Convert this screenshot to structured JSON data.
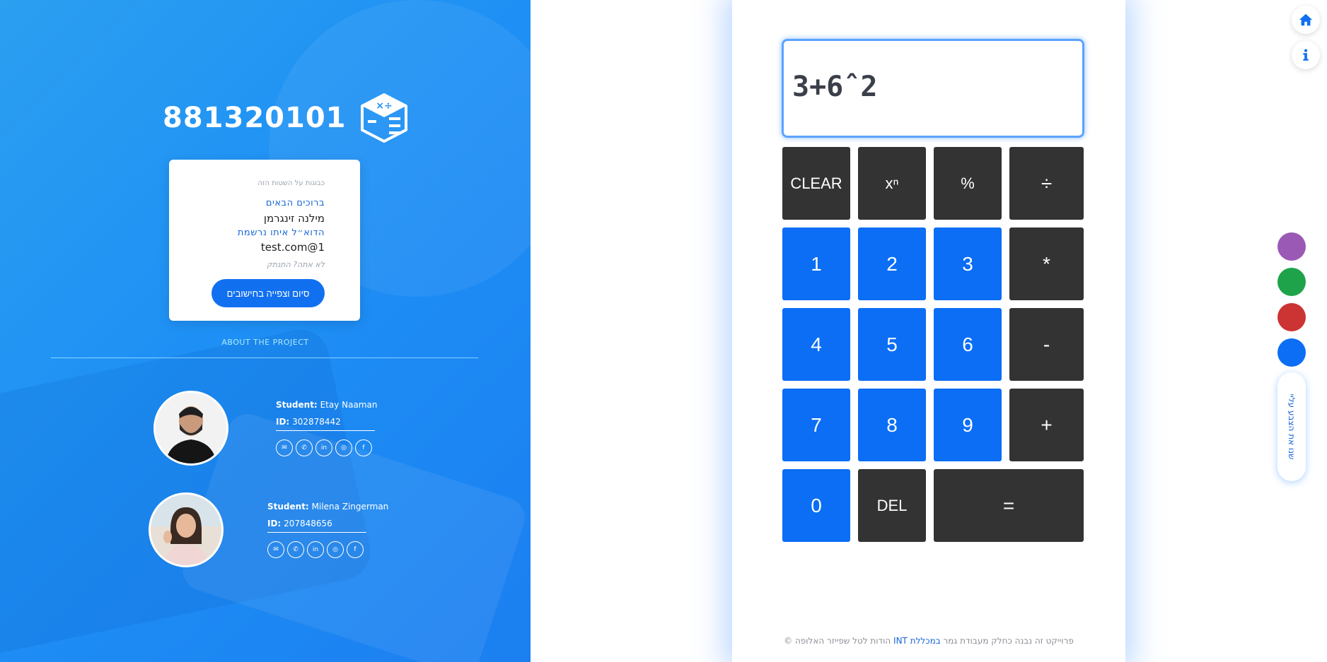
{
  "brand": {
    "number": "881320101"
  },
  "card": {
    "small_text": "כבוגות על השטות הזה",
    "welcome": "ברוכים הבאים",
    "username": "מילנה זינגרמן",
    "registered_label": "הדוא״ל איתו נרשמת",
    "email": "test.com@1",
    "not_you": "לא אתה? התנתק",
    "finish_button": "סיום וצפייה בחישובים"
  },
  "about": "ABOUT THE PROJECT",
  "students": [
    {
      "label": "Student:",
      "name": "Etay Naaman",
      "id_label": "ID:",
      "id": "302878442"
    },
    {
      "label": "Student:",
      "name": "Milena Zingerman",
      "id_label": "ID:",
      "id": "207848656"
    }
  ],
  "socials": [
    {
      "icon": "mail-icon",
      "glyph": "✉"
    },
    {
      "icon": "phone-icon",
      "glyph": "✆"
    },
    {
      "icon": "linkedin-icon",
      "glyph": "in"
    },
    {
      "icon": "instagram-icon",
      "glyph": "◎"
    },
    {
      "icon": "facebook-icon",
      "glyph": "f"
    }
  ],
  "calculator": {
    "display": "3+6ˆ2",
    "keys": {
      "clear": "CLEAR",
      "power": "xⁿ",
      "percent": "%",
      "divide": "÷",
      "one": "1",
      "two": "2",
      "three": "3",
      "multiply": "*",
      "four": "4",
      "five": "5",
      "six": "6",
      "minus": "-",
      "seven": "7",
      "eight": "8",
      "nine": "9",
      "plus": "+",
      "zero": "0",
      "del": "DEL",
      "equals": "="
    }
  },
  "footer": {
    "part1": "פרוייקט זה נבנה כחלק מעבודת גמר ",
    "highlight": "במכללת INT",
    "part2": " הודות לטל שפייזר האלופה ©"
  },
  "right": {
    "home_icon": "home-icon",
    "info_icon": "info-icon",
    "swatches": [
      "#9b59b6",
      "#1ea34a",
      "#cc3333",
      "#0b6ef5"
    ],
    "theme_pill": "שנו את הצבע עליי"
  }
}
